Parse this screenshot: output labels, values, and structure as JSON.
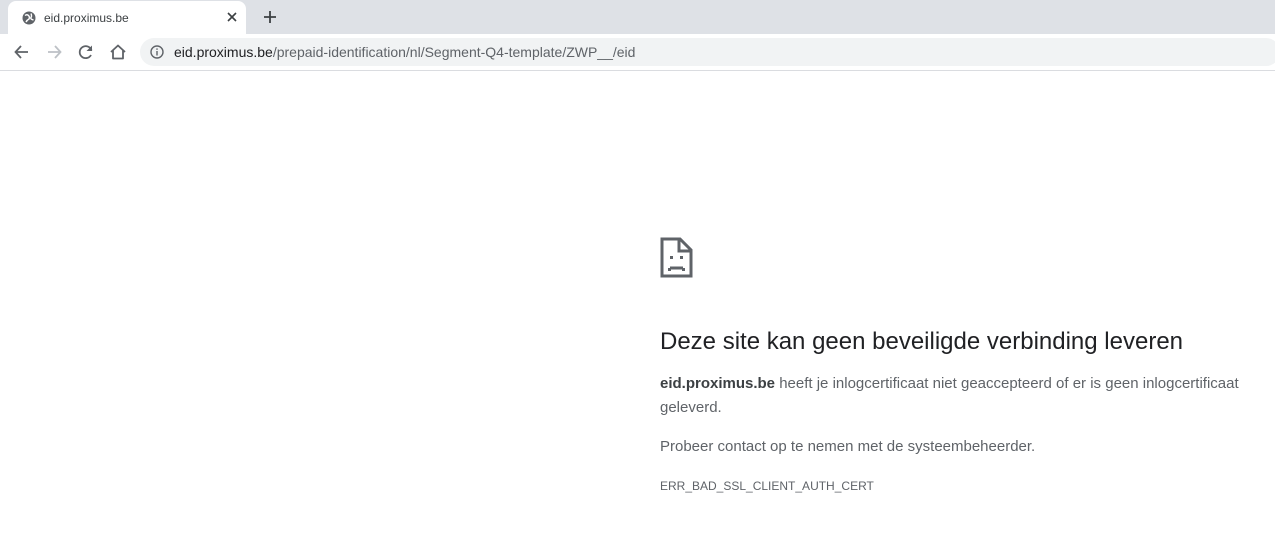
{
  "tab": {
    "title": "eid.proximus.be",
    "favicon": "globe-icon",
    "close_icon": "close-icon",
    "new_tab_icon": "plus-icon"
  },
  "toolbar": {
    "back_icon": "arrow-left-icon",
    "forward_icon": "arrow-right-icon",
    "reload_icon": "reload-icon",
    "home_icon": "home-icon",
    "site_info_icon": "info-icon",
    "url_host": "eid.proximus.be",
    "url_path": "/prepaid-identification/nl/Segment-Q4-template/ZWP__/eid"
  },
  "error": {
    "icon": "sad-document-icon",
    "title": "Deze site kan geen beveiligde verbinding leveren",
    "host": "eid.proximus.be",
    "description": " heeft je inlogcertificaat niet geaccepteerd of er is geen inlogcertificaat geleverd.",
    "suggestion": "Probeer contact op te nemen met de systeembeheerder.",
    "code": "ERR_BAD_SSL_CLIENT_AUTH_CERT"
  },
  "colors": {
    "tabstrip_bg": "#dee1e6",
    "omnibox_bg": "#f1f3f4",
    "text_primary": "#202124",
    "text_secondary": "#5f6368"
  }
}
